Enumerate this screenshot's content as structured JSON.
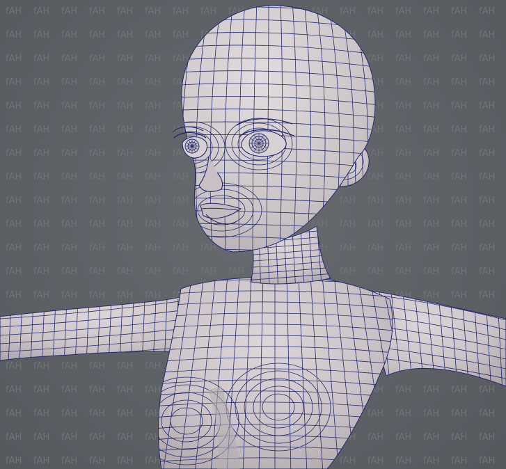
{
  "viewport": {
    "background_color": "#5d6166",
    "mesh_fill_color": "#cfc8cb",
    "mesh_shadow_color": "#b5adb1",
    "wire_color": "#242a6e"
  },
  "watermark": {
    "text": "fAH",
    "color": "#6f7378"
  },
  "model": {
    "subject_icon": "low-poly-female-base-mesh-icon"
  }
}
